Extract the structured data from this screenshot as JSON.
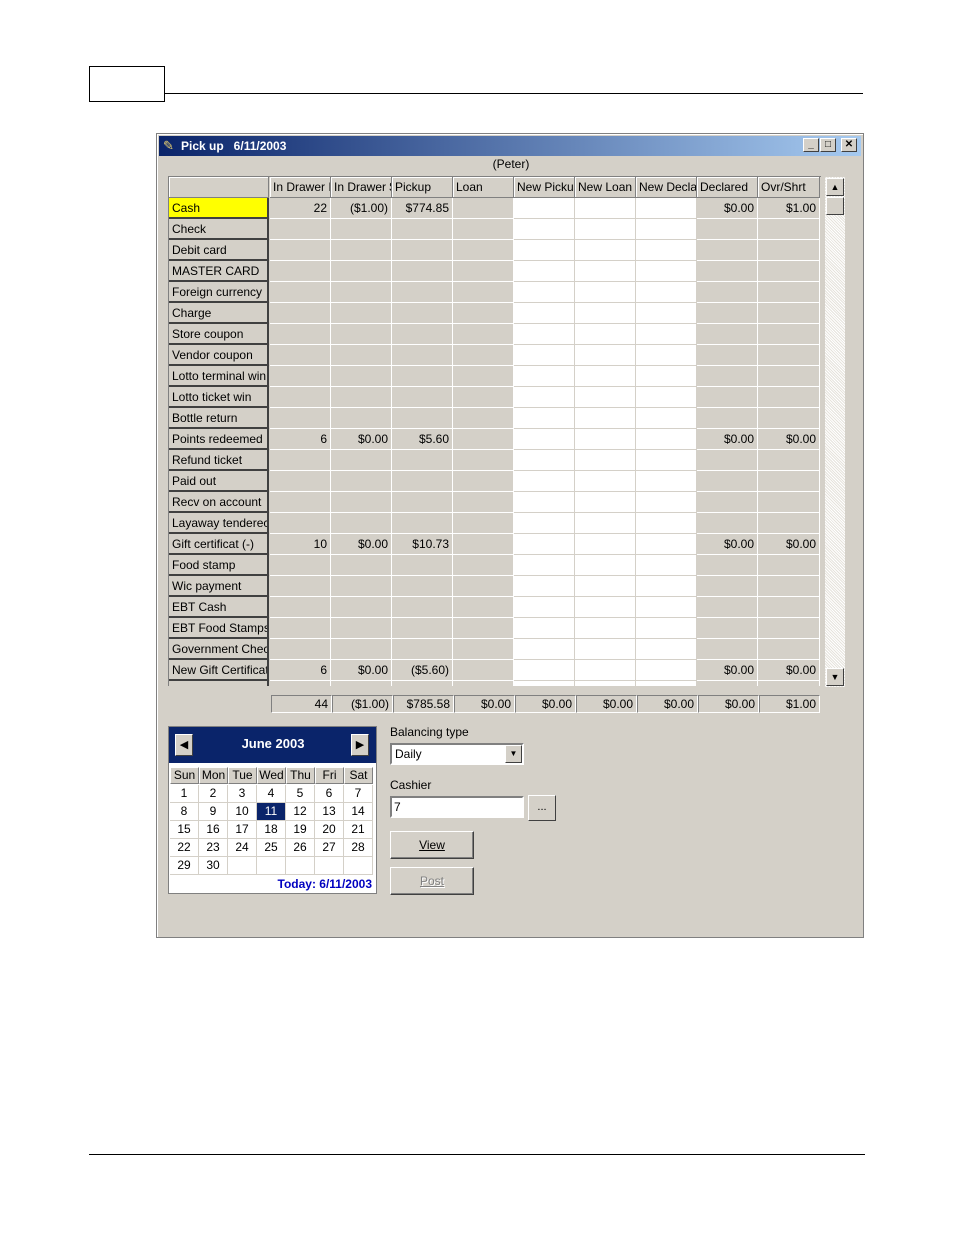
{
  "window": {
    "title": "Pick up   6/11/2003",
    "user": "(Peter)",
    "controls": {
      "minimize": "_",
      "maximize": "□",
      "close": "✕"
    }
  },
  "grid": {
    "columns": [
      "",
      "In Drawer I",
      "In Drawer $",
      "Pickup",
      "Loan",
      "New Picku",
      "New Loan",
      "New Decla",
      "Declared",
      "Ovr/Shrt"
    ],
    "rows": [
      {
        "name": "Cash",
        "values": [
          "22",
          "($1.00)",
          "$774.85",
          "",
          "",
          "",
          "",
          "$0.00",
          "$1.00"
        ]
      },
      {
        "name": "Check",
        "values": [
          "",
          "",
          "",
          "",
          "",
          "",
          "",
          "",
          ""
        ]
      },
      {
        "name": "Debit card",
        "values": [
          "",
          "",
          "",
          "",
          "",
          "",
          "",
          "",
          ""
        ]
      },
      {
        "name": "MASTER CARD",
        "values": [
          "",
          "",
          "",
          "",
          "",
          "",
          "",
          "",
          ""
        ]
      },
      {
        "name": "Foreign currency",
        "values": [
          "",
          "",
          "",
          "",
          "",
          "",
          "",
          "",
          ""
        ]
      },
      {
        "name": "Charge",
        "values": [
          "",
          "",
          "",
          "",
          "",
          "",
          "",
          "",
          ""
        ]
      },
      {
        "name": "Store coupon",
        "values": [
          "",
          "",
          "",
          "",
          "",
          "",
          "",
          "",
          ""
        ]
      },
      {
        "name": "Vendor coupon",
        "values": [
          "",
          "",
          "",
          "",
          "",
          "",
          "",
          "",
          ""
        ]
      },
      {
        "name": "Lotto terminal win",
        "values": [
          "",
          "",
          "",
          "",
          "",
          "",
          "",
          "",
          ""
        ]
      },
      {
        "name": "Lotto ticket win",
        "values": [
          "",
          "",
          "",
          "",
          "",
          "",
          "",
          "",
          ""
        ]
      },
      {
        "name": "Bottle return",
        "values": [
          "",
          "",
          "",
          "",
          "",
          "",
          "",
          "",
          ""
        ]
      },
      {
        "name": "Points redeemed",
        "values": [
          "6",
          "$0.00",
          "$5.60",
          "",
          "",
          "",
          "",
          "$0.00",
          "$0.00"
        ]
      },
      {
        "name": "Refund ticket",
        "values": [
          "",
          "",
          "",
          "",
          "",
          "",
          "",
          "",
          ""
        ]
      },
      {
        "name": "Paid out",
        "values": [
          "",
          "",
          "",
          "",
          "",
          "",
          "",
          "",
          ""
        ]
      },
      {
        "name": "Recv on account",
        "values": [
          "",
          "",
          "",
          "",
          "",
          "",
          "",
          "",
          ""
        ]
      },
      {
        "name": "Layaway tenderec",
        "values": [
          "",
          "",
          "",
          "",
          "",
          "",
          "",
          "",
          ""
        ]
      },
      {
        "name": "Gift certificat (-)",
        "values": [
          "10",
          "$0.00",
          "$10.73",
          "",
          "",
          "",
          "",
          "$0.00",
          "$0.00"
        ]
      },
      {
        "name": "Food stamp",
        "values": [
          "",
          "",
          "",
          "",
          "",
          "",
          "",
          "",
          ""
        ]
      },
      {
        "name": "Wic payment",
        "values": [
          "",
          "",
          "",
          "",
          "",
          "",
          "",
          "",
          ""
        ]
      },
      {
        "name": "EBT Cash",
        "values": [
          "",
          "",
          "",
          "",
          "",
          "",
          "",
          "",
          ""
        ]
      },
      {
        "name": "EBT Food Stamps",
        "values": [
          "",
          "",
          "",
          "",
          "",
          "",
          "",
          "",
          ""
        ]
      },
      {
        "name": "Government Checl",
        "values": [
          "",
          "",
          "",
          "",
          "",
          "",
          "",
          "",
          ""
        ]
      },
      {
        "name": "New Gift Certificat",
        "values": [
          "6",
          "$0.00",
          "($5.60)",
          "",
          "",
          "",
          "",
          "$0.00",
          "$0.00"
        ]
      }
    ],
    "selected_row": "Cash",
    "totals": [
      "44",
      "($1.00)",
      "$785.58",
      "$0.00",
      "$0.00",
      "$0.00",
      "$0.00",
      "$0.00",
      "$1.00"
    ]
  },
  "scrollbar": {
    "up": "▲",
    "down": "▼"
  },
  "calendar": {
    "month_label": "June  2003",
    "prev": "◀",
    "next": "▶",
    "weekdays": [
      "Sun",
      "Mon",
      "Tue",
      "Wed",
      "Thu",
      "Fri",
      "Sat"
    ],
    "weeks": [
      [
        "1",
        "2",
        "3",
        "4",
        "5",
        "6",
        "7"
      ],
      [
        "8",
        "9",
        "10",
        "11",
        "12",
        "13",
        "14"
      ],
      [
        "15",
        "16",
        "17",
        "18",
        "19",
        "20",
        "21"
      ],
      [
        "22",
        "23",
        "24",
        "25",
        "26",
        "27",
        "28"
      ],
      [
        "29",
        "30",
        "",
        "",
        "",
        "",
        ""
      ]
    ],
    "selected_day": "11",
    "today_label": "Today: 6/11/2003"
  },
  "balancing": {
    "label": "Balancing type",
    "value": "Daily",
    "dropdown_icon": "▼"
  },
  "cashier": {
    "label": "Cashier",
    "value": "7",
    "browse_label": "..."
  },
  "buttons": {
    "view": "View",
    "post": "Post"
  }
}
